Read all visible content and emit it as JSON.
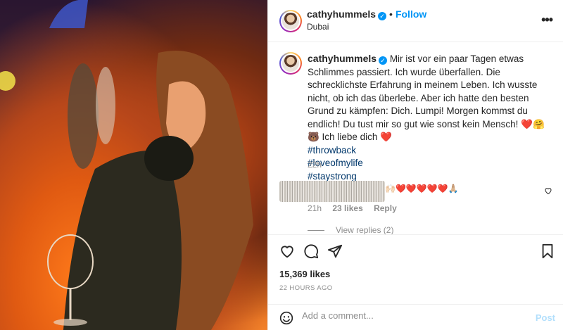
{
  "post": {
    "username": "cathyhummels",
    "follow_label": "Follow",
    "separator": "•",
    "location": "Dubai",
    "more_label": "•••"
  },
  "caption": {
    "username": "cathyhummels",
    "body": "Mir ist vor ein paar Tagen etwas Schlimmes passiert. Ich wurde überfallen. Die schrecklichste Erfahrung in meinem Leben. Ich wusste nicht, ob ich das überlebe. Aber ich hatte den besten Grund zu kämpfen: Dich. Lumpi! Morgen kommst du endlich! Du tust mir so gut wie sonst kein Mensch! ❤️🤗🐻 Ich liebe dich ❤️",
    "hashtags": [
      "#throwback",
      "#loveofmylife",
      "#staystrong"
    ],
    "time": "22h"
  },
  "comment": {
    "emojis": "🙌🏻❤️❤️❤️❤️❤️🙏🏼",
    "time": "21h",
    "likes": "23 likes",
    "reply_label": "Reply",
    "view_replies": "View replies (2)"
  },
  "stats": {
    "likes": "15,369 likes",
    "ago": "22 HOURS AGO"
  },
  "composer": {
    "placeholder": "Add a comment...",
    "post_label": "Post"
  },
  "icons": {
    "like": "heart-icon",
    "comment": "comment-icon",
    "share": "share-icon",
    "save": "bookmark-icon",
    "emoji": "emoji-icon",
    "verified": "verified-badge-icon",
    "more": "more-options-icon"
  },
  "colors": {
    "accent": "#0095f6",
    "hashtag": "#00376b",
    "muted": "#8e8e8e",
    "post_disabled": "#b2dffc"
  }
}
